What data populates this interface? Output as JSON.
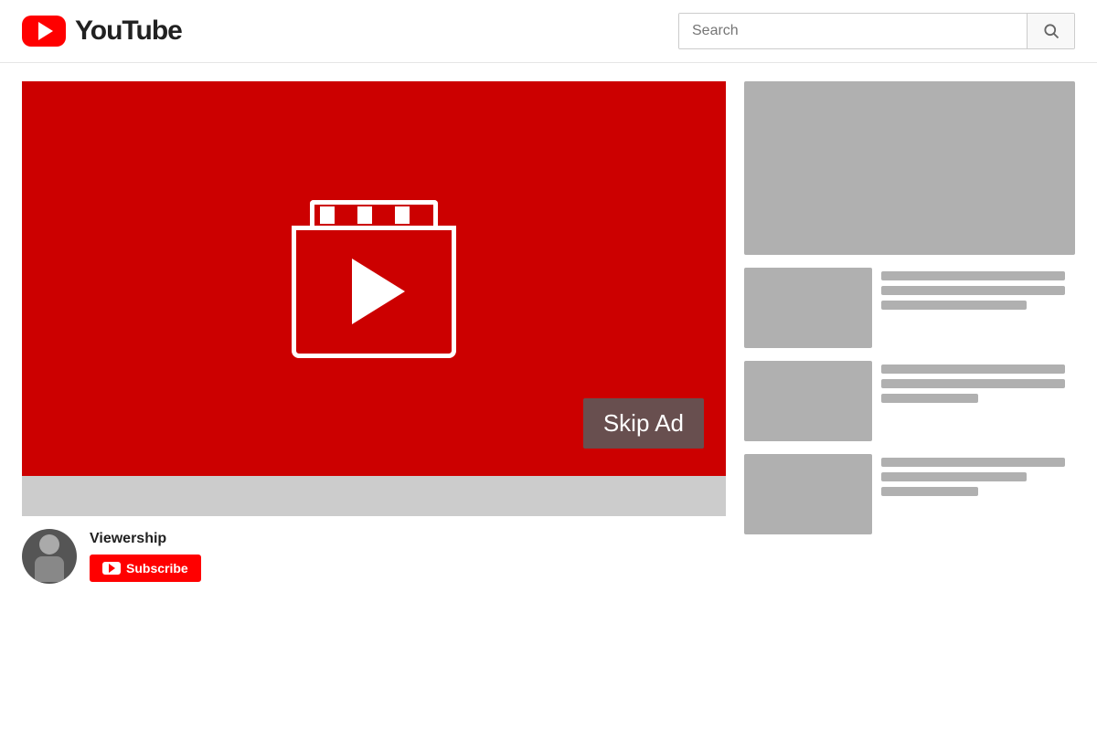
{
  "header": {
    "logo_text": "YouTube",
    "search_placeholder": "Search",
    "search_btn_label": "Search"
  },
  "video": {
    "skip_ad_label": "Skip Ad",
    "channel_name": "Viewership",
    "subscribe_label": "Subscribe"
  },
  "sidebar": {
    "ad_banner_alt": "Advertisement banner",
    "suggested_items": [
      {
        "id": 1
      },
      {
        "id": 2
      },
      {
        "id": 3
      }
    ]
  }
}
